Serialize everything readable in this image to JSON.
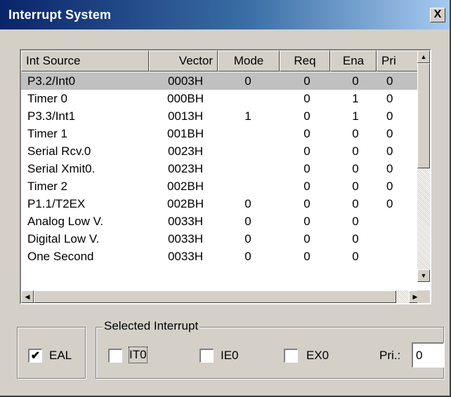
{
  "window": {
    "title": "Interrupt System",
    "close_label": "X"
  },
  "list": {
    "columns": [
      "Int Source",
      "Vector",
      "Mode",
      "Req",
      "Ena",
      "Pri"
    ],
    "rows": [
      [
        "P3.2/Int0",
        "0003H",
        "0",
        "0",
        "0",
        "0"
      ],
      [
        "Timer 0",
        "000BH",
        "",
        "0",
        "1",
        "0"
      ],
      [
        "P3.3/Int1",
        "0013H",
        "1",
        "0",
        "1",
        "0"
      ],
      [
        "Timer 1",
        "001BH",
        "",
        "0",
        "0",
        "0"
      ],
      [
        "Serial Rcv.0",
        "0023H",
        "",
        "0",
        "0",
        "0"
      ],
      [
        "Serial Xmit0.",
        "0023H",
        "",
        "0",
        "0",
        "0"
      ],
      [
        "Timer 2",
        "002BH",
        "",
        "0",
        "0",
        "0"
      ],
      [
        "P1.1/T2EX",
        "002BH",
        "0",
        "0",
        "0",
        "0"
      ],
      [
        "Analog Low V.",
        "0033H",
        "0",
        "0",
        "0",
        ""
      ],
      [
        "Digital Low V.",
        "0033H",
        "0",
        "0",
        "0",
        ""
      ],
      [
        "One Second",
        "0033H",
        "0",
        "0",
        "0",
        ""
      ]
    ],
    "selected_row": 0
  },
  "eal": {
    "label": "EAL",
    "checked": true,
    "check_glyph": "✔"
  },
  "selected_interrupt": {
    "legend": "Selected Interrupt",
    "it0_label": "IT0",
    "ie0_label": "IE0",
    "ex0_label": "EX0",
    "pri_label": "Pri.:",
    "pri_value": "0"
  }
}
